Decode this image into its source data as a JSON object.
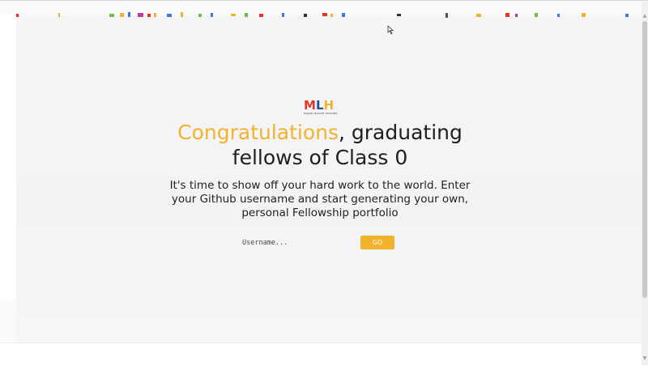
{
  "logo": {
    "letters": [
      "M",
      "L",
      "H"
    ],
    "letter_colors": [
      "#e73427",
      "#1f4eae",
      "#f1b32b"
    ],
    "subtitle": "MAJOR LEAGUE HACKING"
  },
  "heading": {
    "accent": "Congratulations",
    "rest": ", graduating fellows of Class 0"
  },
  "subheading": "It's time to show off your hard work to the world. Enter your Github username and start generating your own, personal Fellowship portfolio",
  "form": {
    "username_value": "",
    "username_placeholder": "Username...",
    "go_label": "GO"
  },
  "colors": {
    "accent": "#f1b32b",
    "text": "#1f1f1f",
    "background": "#f4f4f6"
  },
  "icons": {
    "cursor": "mouse-pointer-icon",
    "scroll_up": "scroll-up-arrow-icon",
    "scroll_down": "scroll-down-arrow-icon"
  }
}
